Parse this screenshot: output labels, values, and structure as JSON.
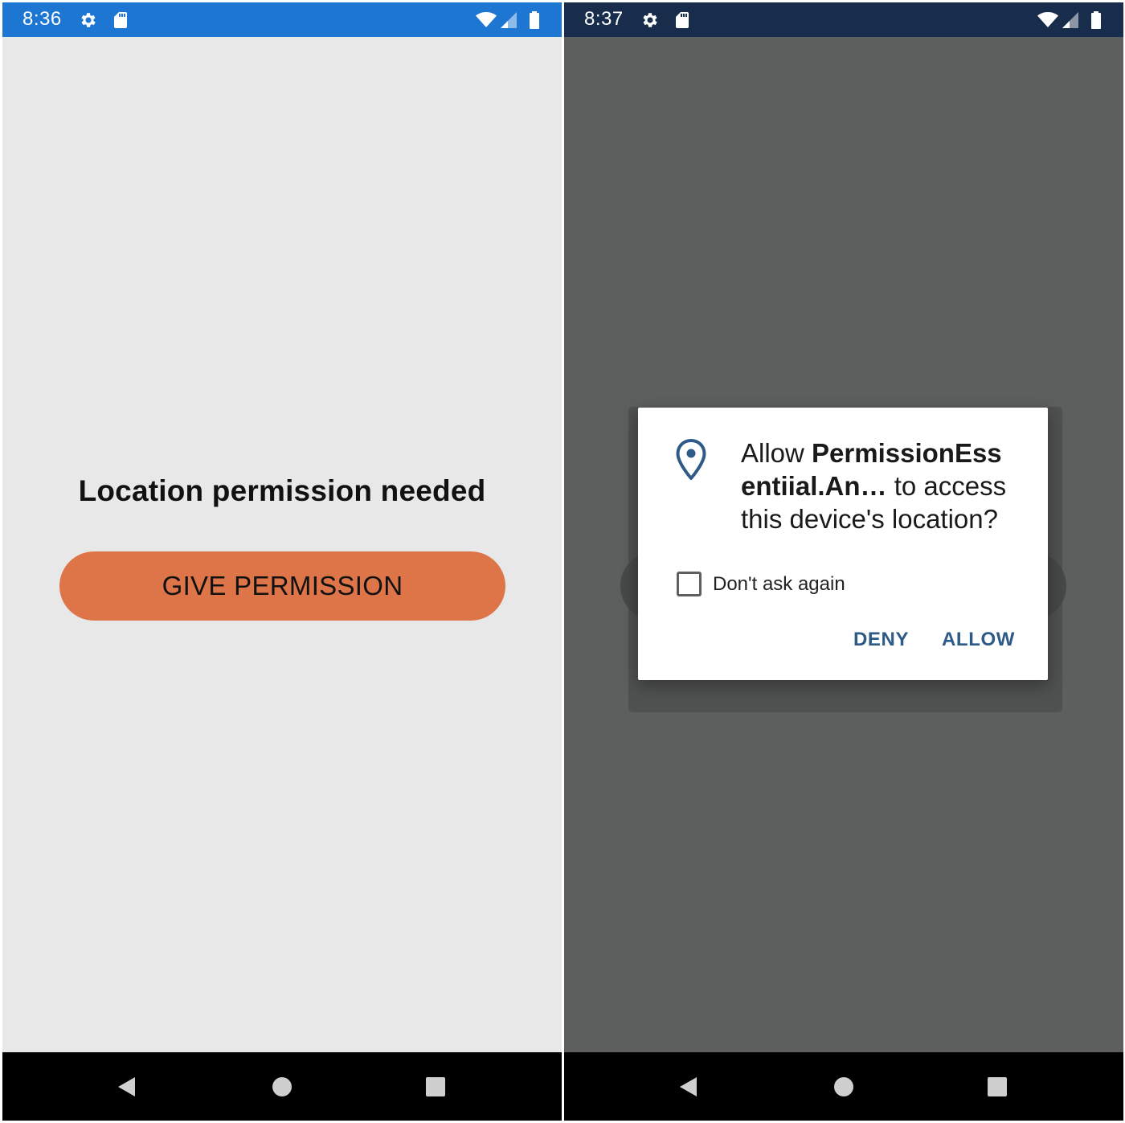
{
  "left_screen": {
    "status_bar": {
      "time": "8:36",
      "color": "#1e76d3"
    },
    "headline": "Location permission needed",
    "button": {
      "label": "GIVE PERMISSION",
      "color": "#dd7548"
    },
    "background": "#e8e8e8"
  },
  "right_screen": {
    "status_bar": {
      "time": "8:37",
      "color": "#182d4c"
    },
    "background": "#5d5f5e",
    "dialog": {
      "icon": "location-pin-icon",
      "message_prefix": "Allow ",
      "app_name_line1": "PermissionEss",
      "app_name_line2": "entiial.An…",
      "message_suffix_line2": " to access",
      "message_line3": "this device's location?",
      "checkbox_label": "Don't ask again",
      "checkbox_checked": false,
      "deny_label": "DENY",
      "allow_label": "ALLOW",
      "button_color": "#2d5a87"
    }
  },
  "nav_bar": {
    "icons": [
      "back-icon",
      "home-icon",
      "recents-icon"
    ]
  },
  "status_icons": [
    "gear-icon",
    "sd-card-icon",
    "wifi-icon",
    "signal-icon",
    "battery-icon"
  ]
}
